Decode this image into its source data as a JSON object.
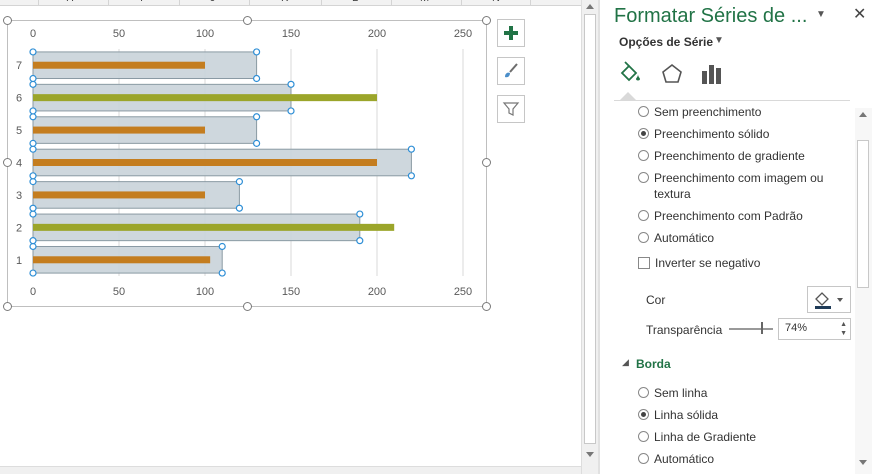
{
  "sheet": {
    "columns": [
      "H",
      "I",
      "J",
      "K",
      "L",
      "M",
      "N"
    ]
  },
  "chart_data": {
    "type": "bar",
    "title": "",
    "xlabel": "",
    "ylabel": "",
    "categories": [
      "1",
      "2",
      "3",
      "4",
      "5",
      "6",
      "7"
    ],
    "xlim": [
      0,
      250
    ],
    "x_ticks": [
      "0",
      "50",
      "100",
      "150",
      "200",
      "250"
    ],
    "grid": true,
    "series": [
      {
        "values": [
          110,
          190,
          120,
          220,
          130,
          150,
          130
        ],
        "color": "#c9d3d9"
      },
      {
        "values": [
          103,
          210,
          100,
          200,
          100,
          200,
          100
        ],
        "colors_by_category": [
          "#c47d1f",
          "#9ba52a",
          "#c47d1f",
          "#c47d1f",
          "#c47d1f",
          "#9ba52a",
          "#c47d1f"
        ]
      }
    ]
  },
  "chart_buttons": {
    "add_element": "plus-icon",
    "styles": "brush-icon",
    "filters": "filter-icon"
  },
  "pane": {
    "title": "Formatar Séries de ...",
    "section_dropdown": "Opções de Série",
    "tabs": [
      "fill-line-icon",
      "effects-icon",
      "series-options-icon"
    ],
    "fill_options": [
      {
        "label": "Sem preenchimento",
        "selected": false
      },
      {
        "label": "Preenchimento sólido",
        "selected": true
      },
      {
        "label": "Preenchimento de gradiente",
        "selected": false
      },
      {
        "label": "Preenchimento com imagem ou textura",
        "selected": false
      },
      {
        "label": "Preenchimento com Padrão",
        "selected": false
      },
      {
        "label": "Automático",
        "selected": false
      }
    ],
    "invert_if_negative": "Inverter se negativo",
    "color_label": "Cor",
    "transparency_label": "Transparência",
    "transparency_value": "74%",
    "border_section": "Borda",
    "border_options": [
      {
        "label": "Sem linha",
        "selected": false
      },
      {
        "label": "Linha sólida",
        "selected": true
      },
      {
        "label": "Linha de Gradiente",
        "selected": false
      },
      {
        "label": "Automático",
        "selected": false
      }
    ],
    "accent_color": "#217346"
  }
}
